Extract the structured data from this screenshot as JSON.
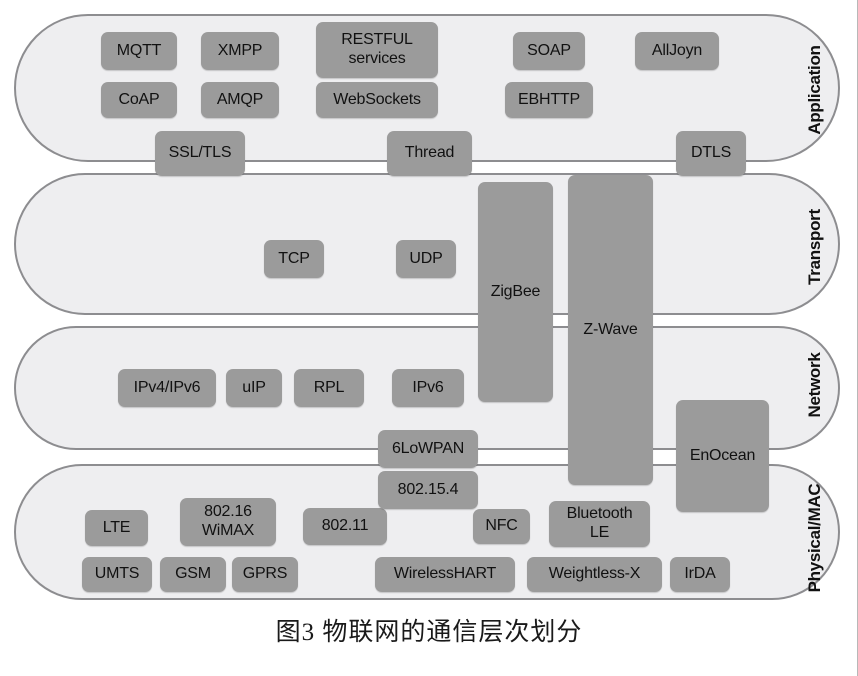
{
  "caption": "图3 物联网的通信层次划分",
  "colors": {
    "box_fill": "#9b9b9b",
    "layer_fill": "#eeeef0",
    "layer_border": "#8d8d90",
    "text": "#111111",
    "page_background": "#ffffff"
  },
  "layers": [
    {
      "id": "application",
      "label": "Application"
    },
    {
      "id": "transport",
      "label": "Transport"
    },
    {
      "id": "network",
      "label": "Network"
    },
    {
      "id": "physical_mac",
      "label": "Physical/MAC"
    }
  ],
  "application": {
    "row1": [
      {
        "label": "MQTT"
      },
      {
        "label": "XMPP"
      },
      {
        "label": "RESTFUL\nservices"
      },
      {
        "label": "SOAP"
      },
      {
        "label": "AllJoyn"
      }
    ],
    "row2": [
      {
        "label": "CoAP"
      },
      {
        "label": "AMQP"
      },
      {
        "label": "WebSockets"
      },
      {
        "label": "EBHTTP"
      }
    ]
  },
  "transport": {
    "items": [
      {
        "label": "TCP"
      },
      {
        "label": "UDP"
      }
    ]
  },
  "network": {
    "items": [
      {
        "label": "IPv4/IPv6"
      },
      {
        "label": "uIP"
      },
      {
        "label": "RPL"
      },
      {
        "label": "IPv6"
      }
    ]
  },
  "physical_mac": {
    "row1": [
      {
        "label": "LTE"
      },
      {
        "label": "802.16\nWiMAX"
      },
      {
        "label": "802.11"
      },
      {
        "label": "NFC"
      },
      {
        "label": "Bluetooth\nLE"
      }
    ],
    "row2": [
      {
        "label": "UMTS"
      },
      {
        "label": "GSM"
      },
      {
        "label": "GPRS"
      },
      {
        "label": "WirelessHART"
      },
      {
        "label": "Weightless-X"
      },
      {
        "label": "IrDA"
      }
    ]
  },
  "boundary_boxes": {
    "application_transport": [
      {
        "label": "SSL/TLS"
      },
      {
        "label": "Thread"
      },
      {
        "label": "DTLS"
      }
    ],
    "network_physical": [
      {
        "label": "6LoWPAN"
      },
      {
        "label": "802.15.4"
      }
    ]
  },
  "spanning_boxes": [
    {
      "label": "ZigBee",
      "spans": "Transport-Network"
    },
    {
      "label": "Z-Wave",
      "spans": "Transport-Physical/MAC"
    },
    {
      "label": "EnOcean",
      "spans": "Network-Physical/MAC"
    }
  ]
}
